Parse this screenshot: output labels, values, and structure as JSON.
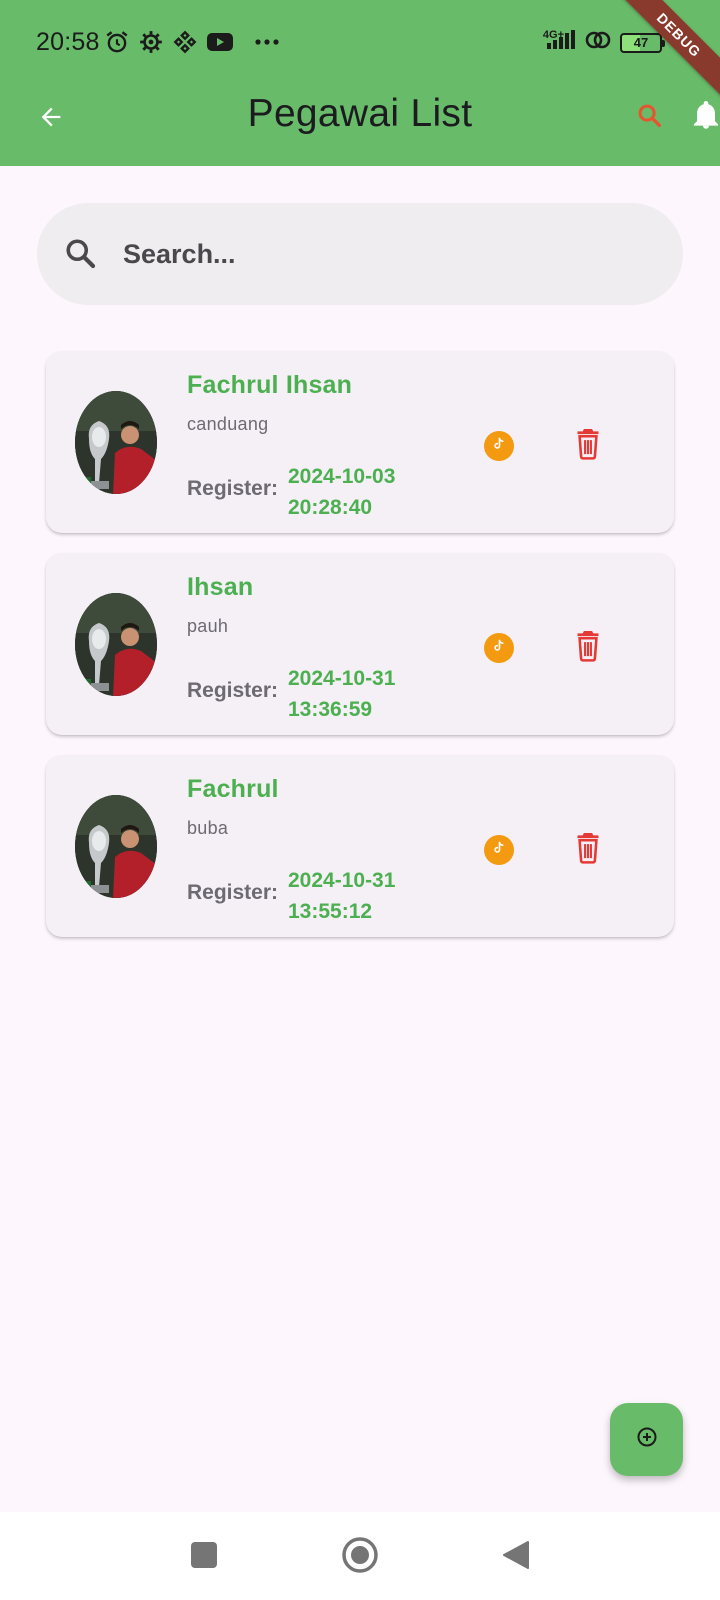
{
  "status_bar": {
    "time": "20:58",
    "network_type": "4G+",
    "battery": "47",
    "left_icons": [
      "alarm-icon",
      "gear-icon",
      "binance-icon",
      "youtube-icon",
      "more-dots-icon"
    ]
  },
  "debug_banner": "DEBUG",
  "app_bar": {
    "title": "Pegawai List",
    "back_icon": "arrow-back-icon",
    "search_icon": "search-icon",
    "notification_icon": "bell-icon"
  },
  "search": {
    "placeholder": "Search...",
    "value": ""
  },
  "employees": [
    {
      "name": "Fachrul Ihsan",
      "sub": "canduang",
      "register_label": "Register:",
      "register_date": "2024-10-03",
      "register_time": "20:28:40"
    },
    {
      "name": "Ihsan",
      "sub": "pauh",
      "register_label": "Register:",
      "register_date": "2024-10-31",
      "register_time": "13:36:59"
    },
    {
      "name": "Fachrul",
      "sub": "buba",
      "register_label": "Register:",
      "register_date": "2024-10-31",
      "register_time": "13:55:12"
    }
  ],
  "fab": {
    "icon": "add-circle-icon"
  },
  "colors": {
    "primary_green": "#68bb69",
    "name_green": "#4caf50",
    "delete_red": "#e53935",
    "tiktok_orange": "#f39a10",
    "search_icon_orange": "#e8542e"
  }
}
